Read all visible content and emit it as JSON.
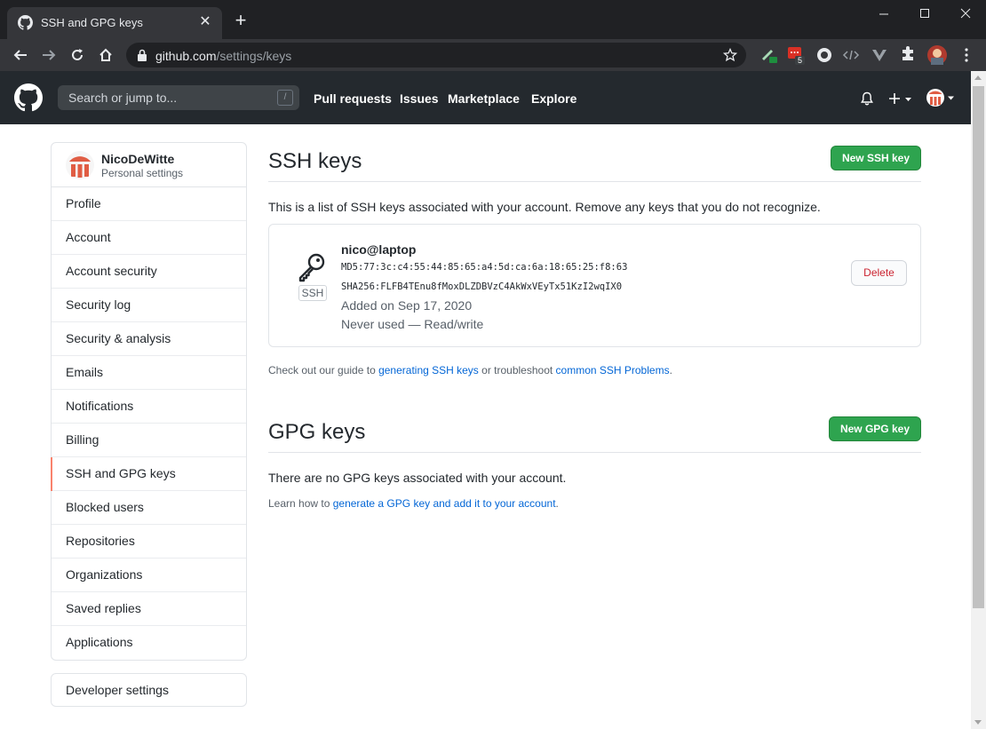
{
  "browser": {
    "tab_title": "SSH and GPG keys",
    "url_host": "github.com",
    "url_path": "/settings/keys",
    "extension_badge": "5"
  },
  "header": {
    "search_placeholder": "Search or jump to...",
    "search_shortcut": "/",
    "nav": [
      "Pull requests",
      "Issues",
      "Marketplace",
      "Explore"
    ]
  },
  "sidebar": {
    "username": "NicoDeWitte",
    "subtitle": "Personal settings",
    "items": [
      "Profile",
      "Account",
      "Account security",
      "Security log",
      "Security & analysis",
      "Emails",
      "Notifications",
      "Billing",
      "SSH and GPG keys",
      "Blocked users",
      "Repositories",
      "Organizations",
      "Saved replies",
      "Applications"
    ],
    "selected": "SSH and GPG keys",
    "developer_settings": "Developer settings"
  },
  "ssh": {
    "title": "SSH keys",
    "new_button": "New SSH key",
    "description": "This is a list of SSH keys associated with your account. Remove any keys that you do not recognize.",
    "key": {
      "badge": "SSH",
      "name": "nico@laptop",
      "md5": "MD5:77:3c:c4:55:44:85:65:a4:5d:ca:6a:18:65:25:f8:63",
      "sha256": "SHA256:FLFB4TEnu8fMoxDLZDBVzC4AkWxVEyTx51KzI2wqIX0",
      "added": "Added on Sep 17, 2020",
      "usage": "Never used — Read/write",
      "delete_label": "Delete"
    },
    "guide_pre": "Check out our guide to ",
    "guide_link1": "generating SSH keys",
    "guide_mid": " or troubleshoot ",
    "guide_link2": "common SSH Problems",
    "guide_post": "."
  },
  "gpg": {
    "title": "GPG keys",
    "new_button": "New GPG key",
    "empty": "There are no GPG keys associated with your account.",
    "learn_pre": "Learn how to ",
    "learn_link": "generate a GPG key and add it to your account",
    "learn_post": "."
  },
  "colors": {
    "header_bg": "#24292e",
    "green_button": "#2ea44f",
    "selected_marker": "#f9826c",
    "link": "#0366d6",
    "delete_red": "#cb2431"
  }
}
